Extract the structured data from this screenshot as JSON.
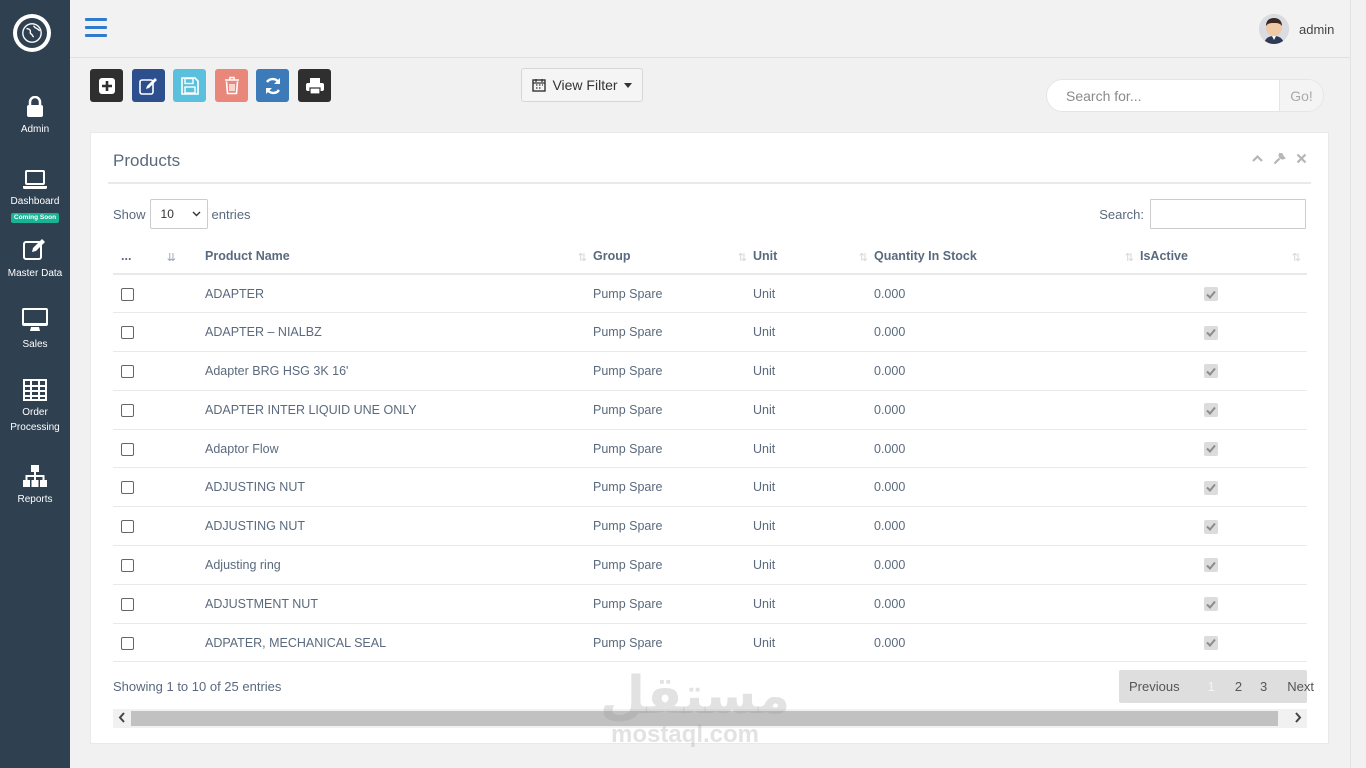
{
  "sidebar": {
    "items": [
      {
        "label": "Admin",
        "icon": "lock-icon"
      },
      {
        "label": "Dashboard",
        "badge": "Coming Soon",
        "icon": "laptop-icon"
      },
      {
        "label": "Master Data",
        "icon": "edit-icon"
      },
      {
        "label": "Sales",
        "icon": "desktop-icon"
      },
      {
        "label": "Order Processing",
        "label_line1": "Order",
        "label_line2": "Processing",
        "icon": "table-icon"
      },
      {
        "label": "Reports",
        "icon": "sitemap-icon"
      }
    ]
  },
  "header": {
    "user": "admin"
  },
  "toolbar": {
    "buttons": [
      {
        "name": "add",
        "color": "#2f2f2f"
      },
      {
        "name": "edit",
        "color": "#2d4f8e"
      },
      {
        "name": "save",
        "color": "#5bc0de"
      },
      {
        "name": "delete",
        "color": "#e8877a"
      },
      {
        "name": "refresh",
        "color": "#3d7ab8"
      },
      {
        "name": "print",
        "color": "#2f2f2f"
      }
    ],
    "view_filter": "View Filter",
    "search_placeholder": "Search for...",
    "go_label": "Go!"
  },
  "panel": {
    "title": "Products",
    "show_label": "Show",
    "entries_value": "10",
    "entries_label": "entries",
    "search_label": "Search:",
    "columns": {
      "select": "...",
      "product_name": "Product Name",
      "group": "Group",
      "unit": "Unit",
      "quantity": "Quantity In Stock",
      "is_active": "IsActive"
    },
    "rows": [
      {
        "name": "ADAPTER",
        "group": "Pump Spare",
        "unit": "Unit",
        "qty": "0.000",
        "active": true
      },
      {
        "name": "ADAPTER – NIALBZ",
        "group": "Pump Spare",
        "unit": "Unit",
        "qty": "0.000",
        "active": true
      },
      {
        "name": "Adapter BRG HSG 3K 16'",
        "group": "Pump Spare",
        "unit": "Unit",
        "qty": "0.000",
        "active": true
      },
      {
        "name": "ADAPTER INTER LIQUID UNE ONLY",
        "group": "Pump Spare",
        "unit": "Unit",
        "qty": "0.000",
        "active": true
      },
      {
        "name": "Adaptor Flow",
        "group": "Pump Spare",
        "unit": "Unit",
        "qty": "0.000",
        "active": true
      },
      {
        "name": "ADJUSTING NUT",
        "group": "Pump Spare",
        "unit": "Unit",
        "qty": "0.000",
        "active": true
      },
      {
        "name": "ADJUSTING NUT",
        "group": "Pump Spare",
        "unit": "Unit",
        "qty": "0.000",
        "active": true
      },
      {
        "name": "Adjusting ring",
        "group": "Pump Spare",
        "unit": "Unit",
        "qty": "0.000",
        "active": true
      },
      {
        "name": "ADJUSTMENT NUT",
        "group": "Pump Spare",
        "unit": "Unit",
        "qty": "0.000",
        "active": true
      },
      {
        "name": "ADPATER, MECHANICAL SEAL",
        "group": "Pump Spare",
        "unit": "Unit",
        "qty": "0.000",
        "active": true
      }
    ],
    "info": "Showing 1 to 10 of 25 entries",
    "pagination": {
      "previous": "Previous",
      "pages": [
        "1",
        "2",
        "3"
      ],
      "current": "1",
      "next": "Next"
    }
  },
  "watermark": {
    "arabic": "مستقل",
    "latin": "mostaql.com"
  }
}
